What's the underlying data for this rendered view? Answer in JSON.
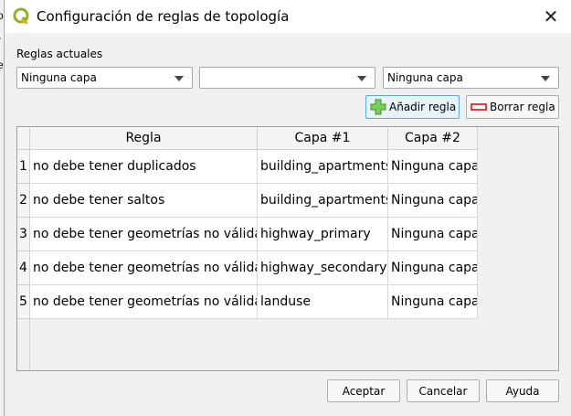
{
  "background_window": {
    "fragments": [
      "o",
      "r",
      "e"
    ]
  },
  "dialog": {
    "title": "Configuración de reglas de topología",
    "close_label": "✕"
  },
  "rules_section": {
    "label": "Reglas actuales",
    "combo_rule_layer": "Ninguna capa",
    "combo_rule_type": "",
    "combo_second_layer": "Ninguna capa",
    "add_button": "Añadir regla",
    "delete_button": "Borrar regla"
  },
  "table": {
    "columns": [
      "Regla",
      "Capa #1",
      "Capa #2"
    ],
    "rows": [
      {
        "num": "1",
        "regla": "no debe tener duplicados",
        "capa1": "building_apartments",
        "capa2": "Ninguna capa"
      },
      {
        "num": "2",
        "regla": "no debe tener saltos",
        "capa1": "building_apartments",
        "capa2": "Ninguna capa"
      },
      {
        "num": "3",
        "regla": "no debe tener geometrías no válidas",
        "capa1": "highway_primary",
        "capa2": "Ninguna capa"
      },
      {
        "num": "4",
        "regla": "no debe tener geometrías no válidas",
        "capa1": "highway_secondary",
        "capa2": "Ninguna capa"
      },
      {
        "num": "5",
        "regla": "no debe tener geometrías no válidas",
        "capa1": "landuse",
        "capa2": "Ninguna capa"
      }
    ]
  },
  "footer": {
    "accept": "Aceptar",
    "cancel": "Cancelar",
    "help": "Ayuda"
  },
  "colors": {
    "qgis_green": "#93b023",
    "add_icon_green": "#5cb85c",
    "delete_icon_red": "#e04040",
    "focus_blue": "#5ca9e0"
  }
}
